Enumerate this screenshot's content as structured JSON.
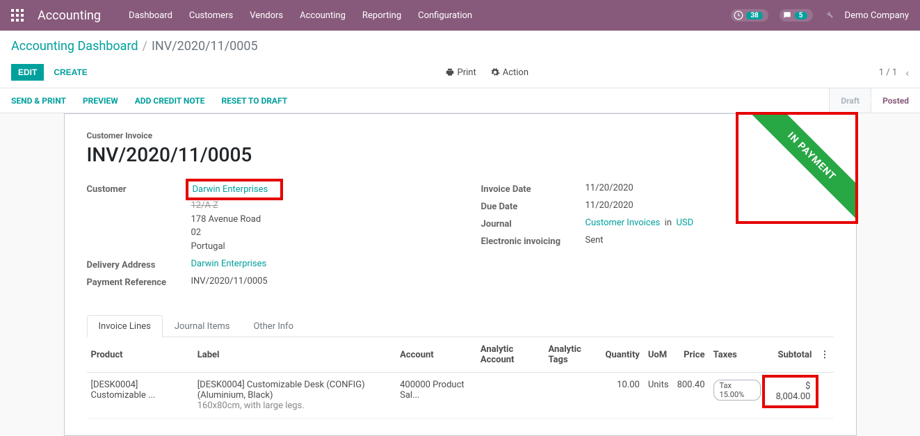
{
  "navbar": {
    "brand": "Accounting",
    "menu": [
      "Dashboard",
      "Customers",
      "Vendors",
      "Accounting",
      "Reporting",
      "Configuration"
    ],
    "activity_count": "38",
    "message_count": "5",
    "company": "Demo Company"
  },
  "breadcrumb": {
    "parent": "Accounting Dashboard",
    "current": "INV/2020/11/0005"
  },
  "control_panel": {
    "edit": "Edit",
    "create": "Create",
    "print": "Print",
    "action": "Action",
    "pager": "1 / 1"
  },
  "statusbar": {
    "actions": [
      "Send & Print",
      "Preview",
      "Add Credit Note",
      "Reset to Draft"
    ],
    "states": {
      "draft": "Draft",
      "posted": "Posted"
    }
  },
  "ribbon": "IN PAYMENT",
  "form": {
    "section_label": "Customer Invoice",
    "title": "INV/2020/11/0005",
    "left": {
      "customer_label": "Customer",
      "customer_name": "Darwin Enterprises",
      "addr1": "12/A Z",
      "addr2": "178 Avenue Road",
      "addr3": "02",
      "addr4": "Portugal",
      "delivery_label": "Delivery Address",
      "delivery_value": "Darwin Enterprises",
      "payref_label": "Payment Reference",
      "payref_value": "INV/2020/11/0005"
    },
    "right": {
      "invdate_label": "Invoice Date",
      "invdate_value": "11/20/2020",
      "duedate_label": "Due Date",
      "duedate_value": "11/20/2020",
      "journal_label": "Journal",
      "journal_value": "Customer Invoices",
      "journal_in": "in",
      "journal_currency": "USD",
      "einv_label": "Electronic invoicing",
      "einv_value": "Sent"
    }
  },
  "tabs": [
    "Invoice Lines",
    "Journal Items",
    "Other Info"
  ],
  "table": {
    "headers": {
      "product": "Product",
      "label": "Label",
      "account": "Account",
      "analytic_account": "Analytic Account",
      "analytic_tags": "Analytic Tags",
      "quantity": "Quantity",
      "uom": "UoM",
      "price": "Price",
      "taxes": "Taxes",
      "subtotal": "Subtotal"
    },
    "row": {
      "product": "[DESK0004] Customizable ...",
      "label_main": "[DESK0004] Customizable Desk (CONFIG) (Aluminium, Black)",
      "label_sub": "160x80cm, with large legs.",
      "account": "400000 Product Sal...",
      "analytic_account": "",
      "analytic_tags": "",
      "quantity": "10.00",
      "uom": "Units",
      "price": "800.40",
      "tax_chip": "Tax 15.00%",
      "subtotal": "$ 8,004.00"
    }
  }
}
